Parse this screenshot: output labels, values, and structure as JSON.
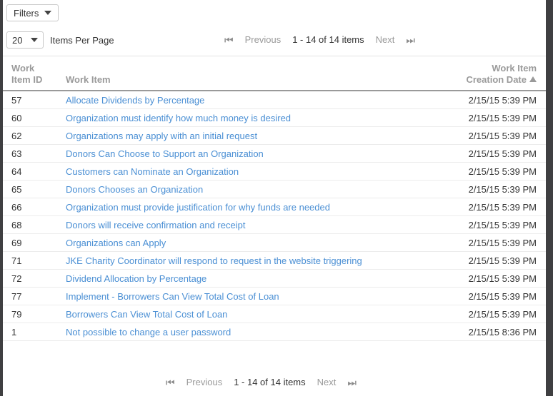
{
  "toolbar": {
    "filters_label": "Filters",
    "items_per_page_value": "20",
    "items_per_page_label": "Items Per Page"
  },
  "pager_top": {
    "first_glyph": "⏮",
    "previous_label": "Previous",
    "range_label": "1 - 14 of 14 items",
    "next_label": "Next",
    "last_glyph": "⏭"
  },
  "pager_bottom": {
    "first_glyph": "⏮",
    "previous_label": "Previous",
    "range_label": "1 - 14 of 14 items",
    "next_label": "Next",
    "last_glyph": "⏭"
  },
  "table": {
    "columns": {
      "id_line1": "Work",
      "id_line2": "Item ID",
      "item": "Work Item",
      "date_line1": "Work Item",
      "date_line2": "Creation Date",
      "sort_direction": "ascending"
    },
    "rows": [
      {
        "id": "57",
        "item": "Allocate Dividends by Percentage",
        "date": "2/15/15 5:39 PM"
      },
      {
        "id": "60",
        "item": "Organization must identify how much money is desired",
        "date": "2/15/15 5:39 PM"
      },
      {
        "id": "62",
        "item": "Organizations may apply with an initial request",
        "date": "2/15/15 5:39 PM"
      },
      {
        "id": "63",
        "item": "Donors Can Choose to Support an Organization",
        "date": "2/15/15 5:39 PM"
      },
      {
        "id": "64",
        "item": "Customers can Nominate an Organization",
        "date": "2/15/15 5:39 PM"
      },
      {
        "id": "65",
        "item": "Donors Chooses an Organization",
        "date": "2/15/15 5:39 PM"
      },
      {
        "id": "66",
        "item": "Organization must provide justification for why funds are needed",
        "date": "2/15/15 5:39 PM"
      },
      {
        "id": "68",
        "item": "Donors will receive confirmation and receipt",
        "date": "2/15/15 5:39 PM"
      },
      {
        "id": "69",
        "item": "Organizations can Apply",
        "date": "2/15/15 5:39 PM"
      },
      {
        "id": "71",
        "item": "JKE Charity Coordinator will respond to request in the website triggering",
        "date": "2/15/15 5:39 PM"
      },
      {
        "id": "72",
        "item": "Dividend Allocation by Percentage",
        "date": "2/15/15 5:39 PM"
      },
      {
        "id": "77",
        "item": "Implement - Borrowers Can View Total Cost of Loan",
        "date": "2/15/15 5:39 PM"
      },
      {
        "id": "79",
        "item": "Borrowers Can View Total Cost of Loan",
        "date": "2/15/15 5:39 PM"
      },
      {
        "id": "1",
        "item": "Not possible to change a user password",
        "date": "2/15/15 8:36 PM"
      }
    ]
  },
  "colors": {
    "link": "#4a8fd4",
    "header_text": "#9a9a9a",
    "body_text": "#333333",
    "row_divider": "#ececec",
    "header_rule": "#9a9a9a",
    "chrome": "#3f3f41"
  }
}
